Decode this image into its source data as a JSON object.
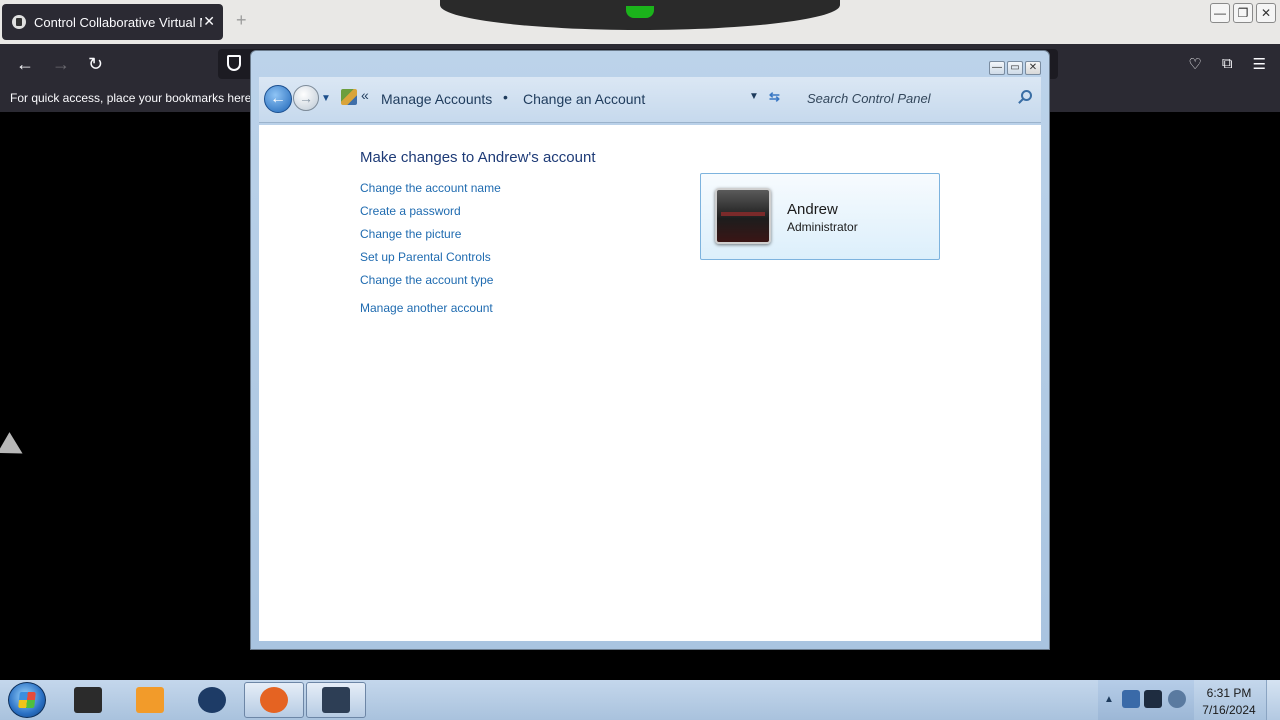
{
  "browser": {
    "tab_title": "Control Collaborative Virtual M",
    "tab_close": "✕",
    "new_tab": "+",
    "bookmarks_hint": "For quick access, place your bookmarks here on the bookmarks toolbar.",
    "nav": {
      "back": "←",
      "forward": "→",
      "reload": "↻"
    },
    "icons": [
      "shield-icon",
      "pocket-icon",
      "extensions-icon",
      "menu-icon"
    ],
    "window_controls": [
      "—",
      "❐",
      "✕"
    ]
  },
  "explorer": {
    "caption_buttons": [
      "—",
      "▭",
      "✕"
    ],
    "breadcrumb": [
      "Manage Accounts",
      "Change an Account"
    ],
    "breadcrumb_overflow": "«",
    "breadcrumb_separator": "•",
    "search_placeholder": "Search Control Panel",
    "heading": "Make changes to Andrew's account",
    "links": [
      "Change the account name",
      "Create a password",
      "Change the picture",
      "Set up Parental Controls",
      "Change the account type",
      "Manage another account"
    ],
    "account": {
      "name": "Andrew",
      "role": "Administrator"
    }
  },
  "taskbar": {
    "pinned": [
      {
        "name": "taskbar-app-1",
        "color": "#2b2b2b"
      },
      {
        "name": "taskbar-media-player",
        "color": "#f29b2a"
      },
      {
        "name": "taskbar-app-3",
        "color": "#1d3b66"
      },
      {
        "name": "taskbar-firefox",
        "color": "#e56322"
      },
      {
        "name": "taskbar-remote-viewer",
        "color": "#2d3e55"
      }
    ],
    "clock_time": "6:31 PM",
    "clock_date": "7/16/2024",
    "tray_arrow": "▲"
  },
  "colors": {
    "link": "#1f6bb0",
    "heading": "#1e3b77",
    "browser_dark": "#2b2a33"
  }
}
